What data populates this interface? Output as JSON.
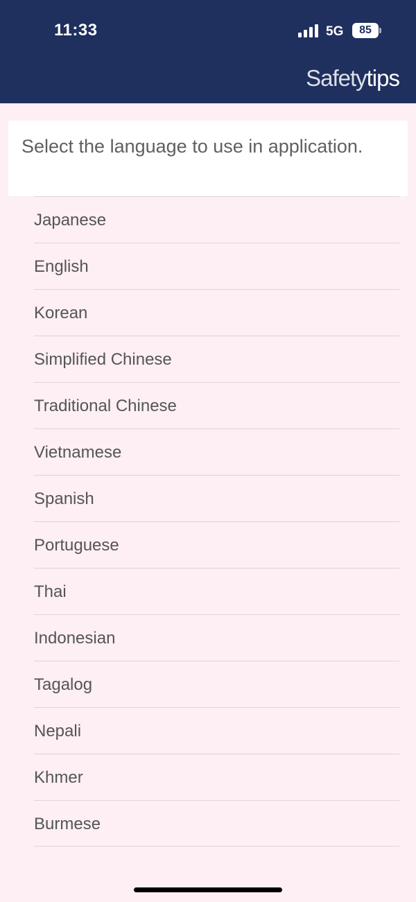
{
  "status_bar": {
    "time": "11:33",
    "network": "5G",
    "battery": "85"
  },
  "header": {
    "brand_part1": "Safety",
    "brand_part2": "tips",
    "background_color": "#1f2f5e"
  },
  "intro": {
    "text": "Select the language to use in application."
  },
  "languages": [
    "Japanese",
    "English",
    "Korean",
    "Simplified Chinese",
    "Traditional Chinese",
    "Vietnamese",
    "Spanish",
    "Portuguese",
    "Thai",
    "Indonesian",
    "Tagalog",
    "Nepali",
    "Khmer",
    "Burmese"
  ]
}
